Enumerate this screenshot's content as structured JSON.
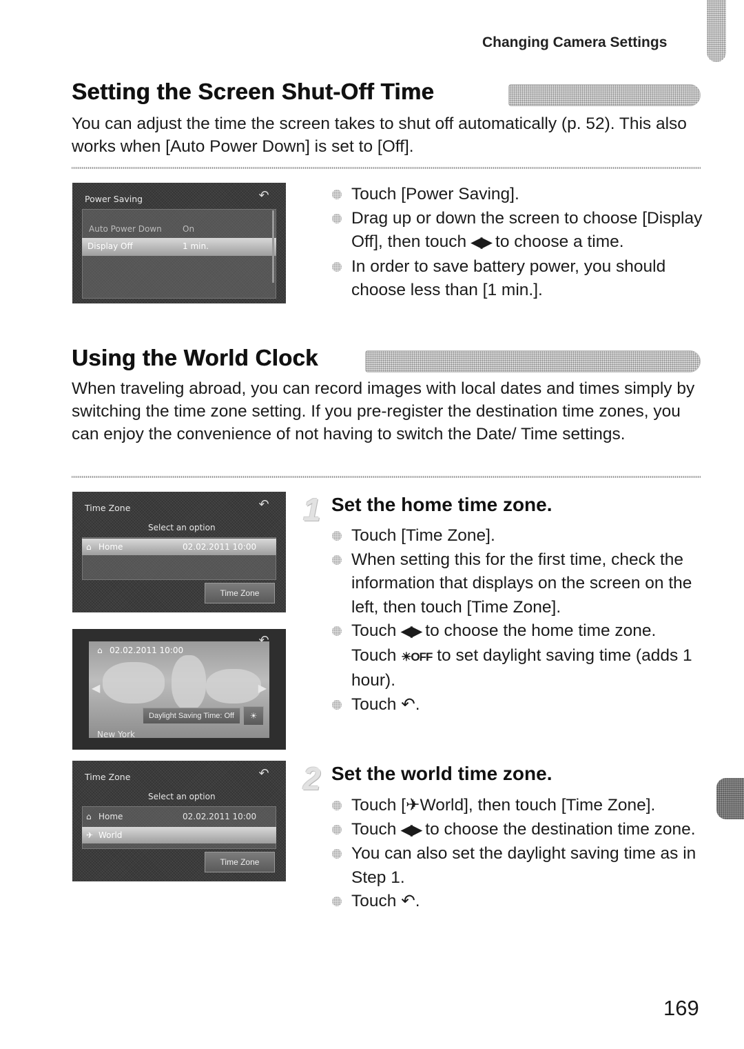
{
  "header": {
    "running_head": "Changing Camera Settings"
  },
  "sections": [
    {
      "title": "Setting the Screen Shut-Off Time",
      "intro": "You can adjust the time the screen takes to shut off automatically (p. 52). This also works when [Auto Power Down] is set to [Off].",
      "screen": {
        "title": "Power Saving",
        "back_icon": "↶",
        "rows": [
          {
            "label": "Auto Power Down",
            "value": "On"
          },
          {
            "label": "Display Off",
            "value": "1 min."
          }
        ]
      },
      "bullets": [
        {
          "text": "Touch [Power Saving]."
        },
        {
          "pre": "Drag up or down the screen to choose [Display Off], then touch ",
          "icon": "◀▶",
          "post": " to choose a time."
        },
        {
          "text": "In order to save battery power, you should choose less than [1 min.]."
        }
      ]
    },
    {
      "title": "Using the World Clock",
      "intro": "When traveling abroad, you can record images with local dates and times simply by switching the time zone setting. If you pre-register the destination time zones, you can enjoy the convenience of not having to switch the Date/ Time settings.",
      "steps": [
        {
          "number": "1",
          "title": "Set the home time zone.",
          "bullets": [
            {
              "text": "Touch [Time Zone]."
            },
            {
              "text": "When setting this for the first time, check the information that displays on the screen on the left, then touch [Time Zone]."
            },
            {
              "pre": "Touch ",
              "icon": "◀▶",
              "post": " to choose the home time zone. Touch ",
              "icon2": "☀OFF",
              "post2": " to set daylight saving time (adds 1 hour)."
            },
            {
              "pre": "Touch ",
              "icon": "↶",
              "post": "."
            }
          ]
        },
        {
          "number": "2",
          "title": "Set the world time zone.",
          "bullets": [
            {
              "pre": "Touch [",
              "icon": "✈",
              "post": "World], then touch [Time Zone]."
            },
            {
              "pre": "Touch ",
              "icon": "◀▶",
              "post": " to choose the destination time zone."
            },
            {
              "text": "You can also set the daylight saving time as in Step 1."
            },
            {
              "pre": "Touch ",
              "icon": "↶",
              "post": "."
            }
          ]
        }
      ],
      "screens": {
        "time_zone_home": {
          "title": "Time Zone",
          "subtitle": "Select an option",
          "home_label": "Home",
          "home_value": "02.02.2011 10:00",
          "button": "Time Zone",
          "back_icon": "↶"
        },
        "map": {
          "datetime": "02.02.2011 10:00",
          "dst_label": "Daylight Saving Time: Off",
          "city": "New York",
          "back_icon": "↶",
          "left_arrow": "◀",
          "right_arrow": "▶"
        },
        "time_zone_world": {
          "title": "Time Zone",
          "subtitle": "Select an option",
          "home_label": "Home",
          "home_value": "02.02.2011 10:00",
          "world_label": "World",
          "button": "Time Zone",
          "back_icon": "↶"
        }
      }
    }
  ],
  "footer": {
    "page_number": "169"
  }
}
